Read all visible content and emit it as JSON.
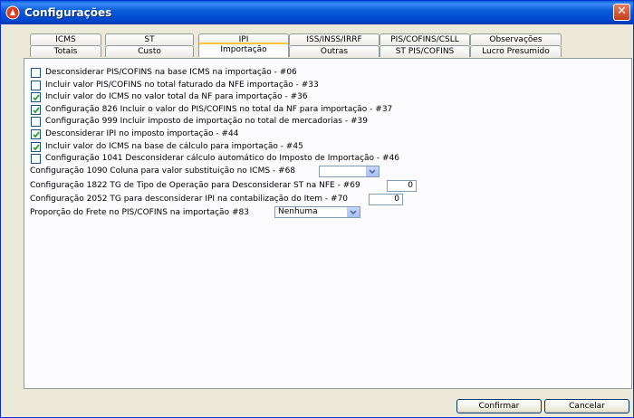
{
  "window": {
    "title": "Configurações"
  },
  "tabs_row1": [
    {
      "label": "ICMS"
    },
    {
      "label": "ST"
    },
    {
      "label": "IPI"
    },
    {
      "label": "ISS/INSS/IRRF"
    },
    {
      "label": "PIS/COFINS/CSLL"
    },
    {
      "label": "Observações"
    }
  ],
  "tabs_row2": [
    {
      "label": "Totais"
    },
    {
      "label": "Custo"
    },
    {
      "label": "Importação"
    },
    {
      "label": "Outras"
    },
    {
      "label": "ST PIS/COFINS"
    },
    {
      "label": "Lucro Presumido"
    }
  ],
  "options": [
    {
      "label": "Desconsiderar PIS/COFINS na base ICMS na importação - #06",
      "checked": false
    },
    {
      "label": "Incluir valor PIS/COFINS no total faturado da NFE importação - #33",
      "checked": false
    },
    {
      "label": "Incluir valor do ICMS no valor total da NF para importação - #36",
      "checked": true
    },
    {
      "label": "Configuração 826 Incluir o valor do PIS/COFINS no total da NF para importação - #37",
      "checked": true
    },
    {
      "label": "Configuração 999 Incluir imposto de importação no total de mercadorias - #39",
      "checked": false
    },
    {
      "label": "Desconsiderar IPI no imposto importação - #44",
      "checked": true
    },
    {
      "label": "Incluir valor do ICMS na base de cálculo para importação - #45",
      "checked": true
    },
    {
      "label": "Configuração 1041 Desconsiderar cálculo automático do Imposto de Importação - #46",
      "checked": false
    }
  ],
  "fields": {
    "config1090": {
      "label": "Configuração 1090 Coluna para valor substituição no ICMS - #68",
      "value": ""
    },
    "config1822": {
      "label": "Configuração 1822 TG de Tipo de Operação para Desconsiderar ST na NFE - #69",
      "value": "0"
    },
    "config2052": {
      "label": "Configuração 2052 TG para desconsiderar IPI na contabilização do Item - #70",
      "value": "0"
    },
    "frete": {
      "label": "Proporção do Frete no PIS/COFINS na importação  #83",
      "value": "Nenhuma"
    }
  },
  "buttons": {
    "confirm": "Confirmar",
    "cancel": "Cancelar"
  },
  "colors": {
    "titlebar": "#0a5fd8",
    "active_tab_accent": "#ffc83c",
    "checkbox_check": "#21a121"
  },
  "icons": {
    "app": "app-icon",
    "close": "close-icon",
    "dropdown": "chevron-down-icon",
    "check": "check-icon"
  }
}
